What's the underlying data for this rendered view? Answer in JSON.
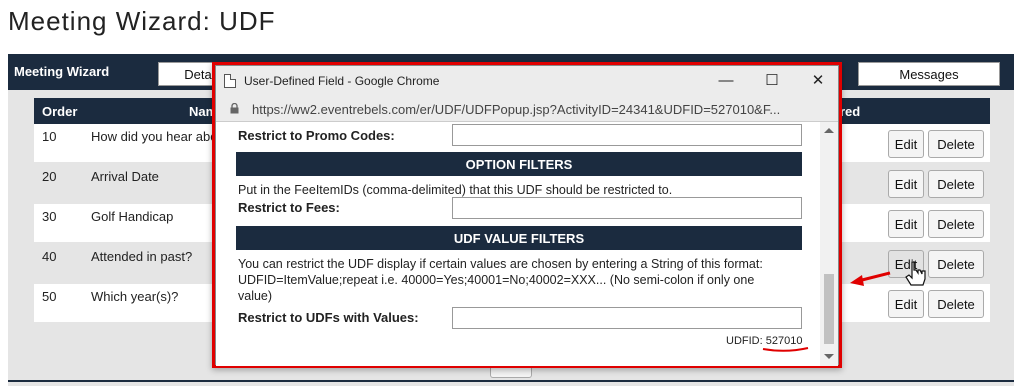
{
  "page_title": "Meeting Wizard: UDF",
  "wizard": {
    "label": "Meeting Wizard",
    "tabs": [
      "Deta",
      "Messages"
    ]
  },
  "table": {
    "headers": {
      "order": "Order",
      "name": "Nam",
      "right": "red"
    },
    "rows": [
      {
        "order": "10",
        "name": "How did you hear abo"
      },
      {
        "order": "20",
        "name": "Arrival Date"
      },
      {
        "order": "30",
        "name": "Golf Handicap"
      },
      {
        "order": "40",
        "name": "Attended in past?"
      },
      {
        "order": "50",
        "name": "Which year(s)?"
      }
    ],
    "edit_label": "Edit",
    "delete_label": "Delete",
    "bottom_button_label": "Edit"
  },
  "popup": {
    "window_title": "User-Defined Field - Google Chrome",
    "url": "https://ww2.eventrebels.com/er/UDF/UDFPopup.jsp?ActivityID=24341&UDFID=527010&F...",
    "restrict_promo_label": "Restrict to Promo Codes:",
    "option_filters_title": "OPTION FILTERS",
    "option_filters_help": "Put in the FeeItemIDs (comma-delimited) that this UDF should be restricted to.",
    "restrict_fees_label": "Restrict to Fees:",
    "udf_value_filters_title": "UDF VALUE FILTERS",
    "udf_value_help_1": "You can restrict the UDF display if certain values are chosen by entering a String of this format:",
    "udf_value_help_2": "UDFID=ItemValue;repeat i.e. 40000=Yes;40001=No;40002=XXX... (No semi-colon if only one",
    "udf_value_help_3": "value)",
    "restrict_udf_label": "Restrict to UDFs with Values:",
    "udfid_label": "UDFID:",
    "udfid_value": "527010",
    "promo_value": "",
    "fees_value": "",
    "udf_values_value": ""
  },
  "colors": {
    "navy": "#1b2b3f",
    "highlight": "#e00000"
  },
  "icons": {
    "lock": "lock-icon",
    "window": "page-icon",
    "cursor": "hand-pointer-icon",
    "arrow": "red-arrow"
  }
}
